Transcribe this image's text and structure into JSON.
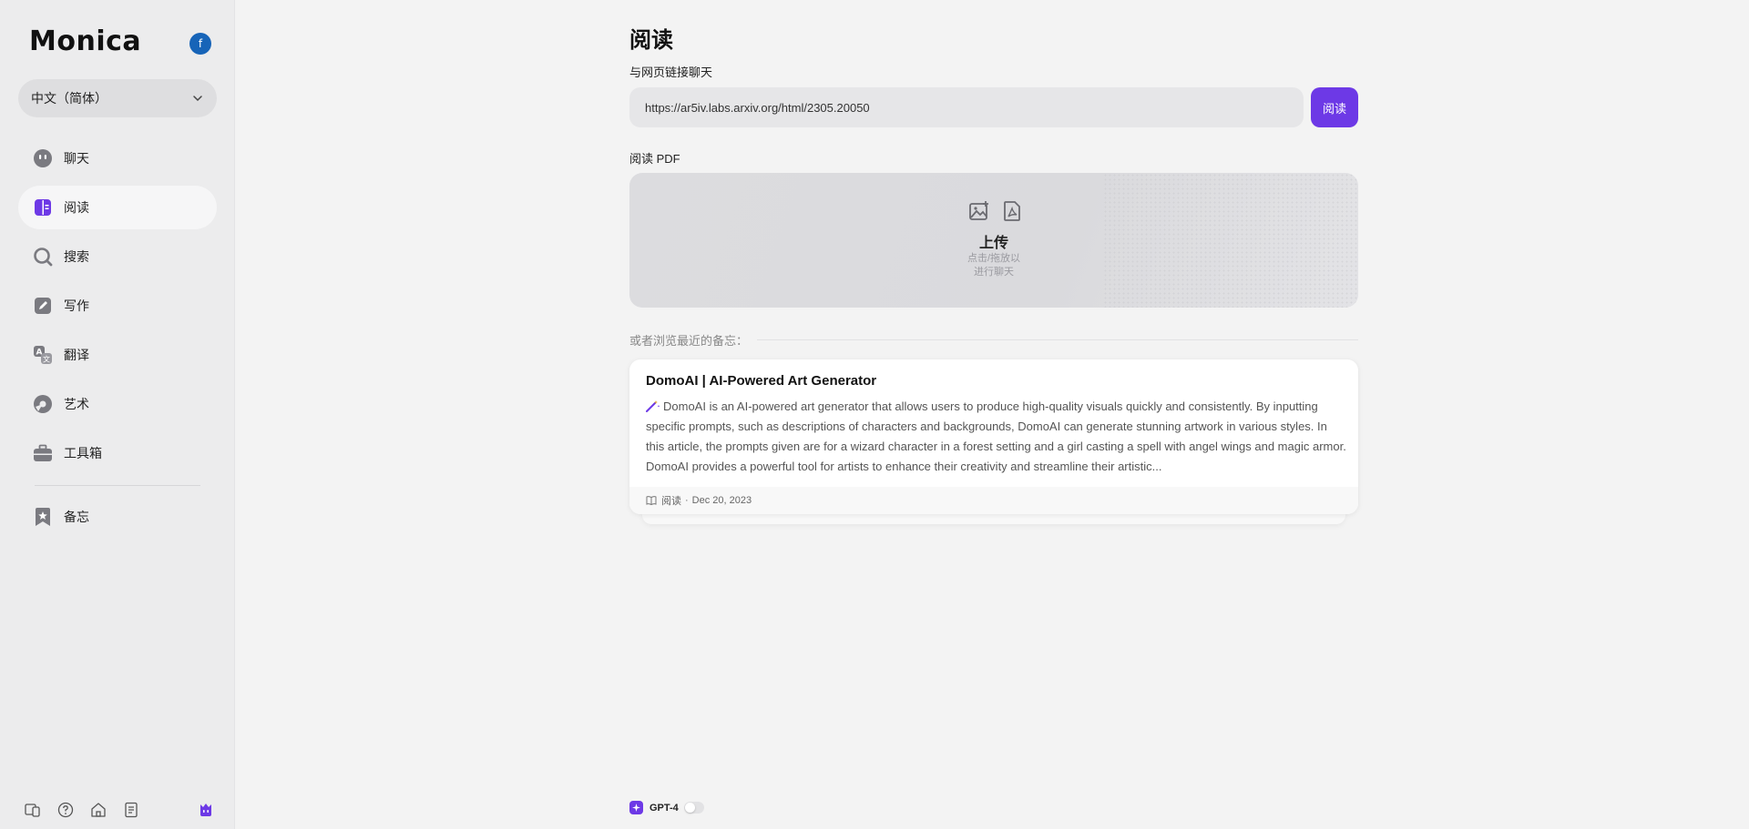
{
  "app": {
    "brand": "Monica",
    "avatar_letter": "f",
    "accent": "#6d39e6"
  },
  "sidebar": {
    "language": "中文（简体）",
    "items": [
      {
        "label": "聊天",
        "icon": "chat-bot-icon"
      },
      {
        "label": "阅读",
        "icon": "read-icon",
        "active": true
      },
      {
        "label": "搜索",
        "icon": "search-icon"
      },
      {
        "label": "写作",
        "icon": "write-icon"
      },
      {
        "label": "翻译",
        "icon": "translate-icon"
      },
      {
        "label": "艺术",
        "icon": "art-icon"
      },
      {
        "label": "工具箱",
        "icon": "toolbox-icon"
      }
    ],
    "memo": {
      "label": "备忘",
      "icon": "memo-icon"
    },
    "bottom_icons": [
      "devices-icon",
      "help-icon",
      "home-icon",
      "notes-icon",
      "monica-icon"
    ]
  },
  "main": {
    "title": "阅读",
    "url_section_label": "与网页链接聊天",
    "url_value": "https://ar5iv.labs.arxiv.org/html/2305.20050",
    "read_button": "阅读",
    "pdf_label": "阅读 PDF",
    "upload": {
      "title": "上传",
      "hint_line1": "点击/拖放以",
      "hint_line2": "进行聊天",
      "icons": [
        "image-upload-icon",
        "pdf-file-icon"
      ]
    },
    "recent_label": "或者浏览最近的备忘：",
    "card": {
      "title": "DomoAI | AI-Powered Art Generator",
      "body": "DomoAI is an AI-powered art generator that allows users to produce high-quality visuals quickly and consistently. By inputting specific prompts, such as descriptions of characters and backgrounds, DomoAI can generate stunning artwork in various styles. In this article, the prompts given are for a wizard character in a forest setting and a girl casting a spell with angel wings and magic armor. DomoAI provides a powerful tool for artists to enhance their creativity and streamline their artistic...",
      "footer_type": "阅读",
      "footer_sep": "·",
      "footer_date": "Dec 20, 2023"
    },
    "model": {
      "name": "GPT-4",
      "toggle_on": false
    }
  }
}
